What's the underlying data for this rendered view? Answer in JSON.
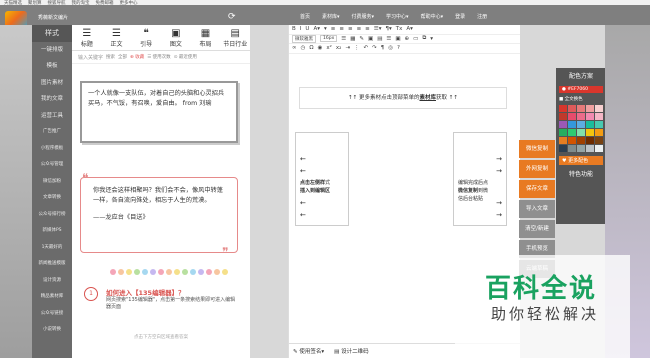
{
  "bookmarks": [
    "天猫精选",
    "聚划算",
    "搜狐导航",
    "我的淘宝",
    "免费邮箱",
    "更多中心"
  ],
  "topbar": {
    "brand": "秀薇新文编片",
    "nav": [
      "首页",
      "素材库▾",
      "付费服务▾",
      "学习中心▾",
      "帮助中心▾",
      "登录",
      "注册"
    ]
  },
  "sidebar": {
    "items": [
      "样式",
      "一键排版",
      "模板",
      "图片素材",
      "我的文章",
      "运营工具",
      "广告推广",
      "小程序模板",
      "公众号管理",
      "微信加粉",
      "文章转换",
      "公众号排行榜",
      "新媒体PS",
      "1天最好的",
      "新闻推送模版",
      "设计资源",
      "精品素材库",
      "公众号链接",
      "小说转换"
    ]
  },
  "tools": [
    {
      "icon": "title-icon",
      "glyph": "☰",
      "label": "标题"
    },
    {
      "icon": "text-icon",
      "glyph": "☰",
      "label": "正文"
    },
    {
      "icon": "quote-icon",
      "glyph": "❝",
      "label": "引导"
    },
    {
      "icon": "image-icon",
      "glyph": "▣",
      "label": "图文"
    },
    {
      "icon": "layout-icon",
      "glyph": "▦",
      "label": "布局"
    },
    {
      "icon": "holiday-icon",
      "glyph": "▤",
      "label": "节日行业"
    }
  ],
  "search": {
    "placeholder": "输入关键字",
    "options": [
      "搜索",
      "全部",
      "⊕ 收藏",
      "☰ 使用次数",
      "⊙ 最近使用"
    ]
  },
  "card1": {
    "text": "一个人就像一支队伍，对着自己的头脑和心灵招兵买马，不气馁，有召唤，爱自由。 from 刘瑜"
  },
  "card2": {
    "text": "你我还会这样相聚吗？我们会不会，像风中转蓬一样，各自流向殊处，相忘于人生的荒漠。",
    "author": "——龙应台《目送》"
  },
  "how": {
    "num": "1",
    "title": "如何进入【135编辑器】？",
    "desc": "网页搜索\"135编辑器\"，点击第一条搜索结果即可进入编辑器页面"
  },
  "foot": "点击下方空白区域查看答案",
  "editor": {
    "row1": [
      "B",
      "I",
      "U",
      "A▾",
      "▾",
      "≡",
      "≡",
      "≡",
      "≡",
      "≡",
      "☰▾",
      "¶▾",
      "Tx",
      "A▾"
    ],
    "row2": [
      "微软雅黑",
      "16px",
      "☰",
      "▦",
      "✎",
      "▣",
      "▤",
      "☰",
      "▣",
      "⊕",
      "▭",
      "⧉",
      "▾"
    ],
    "row3": [
      "∞",
      "◷",
      "Ω",
      "◉",
      "x²",
      "x₂",
      "⇥",
      "⋮",
      "↶",
      "↷",
      "¶",
      "◎",
      "?"
    ],
    "hint": "↑↑ 更多素材点击顶部菜单的",
    "hint_bold": "素材库",
    "hint_tail": "获取 ↑↑",
    "left_text": [
      "点击左侧样",
      "式",
      "插入到编辑区"
    ],
    "right_text": [
      "编辑完成后点",
      "微信复制",
      "到微",
      "信后台粘贴"
    ],
    "bottom": [
      "✎ 使用签名▾",
      "▤ 设计二维码"
    ]
  },
  "side_buttons": [
    "微信复制",
    "外网复制",
    "保存文章",
    "导入文章",
    "清空/新建",
    "手机预览",
    "云端草稿"
  ],
  "scheme": {
    "title": "配色方案",
    "picker": "● #EF7060",
    "all": "■ 全文换色",
    "more": "♥ 更多配色",
    "special": "特色功能"
  },
  "swatches": [
    "#d9362c",
    "#e05a5a",
    "#e87a7a",
    "#f0a0a0",
    "#f7d0d0",
    "#c0392b",
    "#e74c6c",
    "#ec6b8a",
    "#f28ab0",
    "#f5b6c6",
    "#9b59b6",
    "#3498db",
    "#5dade2",
    "#1abc9c",
    "#48c9b0",
    "#27ae60",
    "#2ecc71",
    "#82e0aa",
    "#f1c40f",
    "#f39c12",
    "#e67e22",
    "#d35400",
    "#a04000",
    "#6e2c00",
    "#784212",
    "#2c3e50",
    "#7f8c8d",
    "#95a5a6",
    "#bdc3c7",
    "#ecf0f1"
  ],
  "watermark": {
    "line1": "百科全说",
    "line2": "助你轻松解决"
  }
}
